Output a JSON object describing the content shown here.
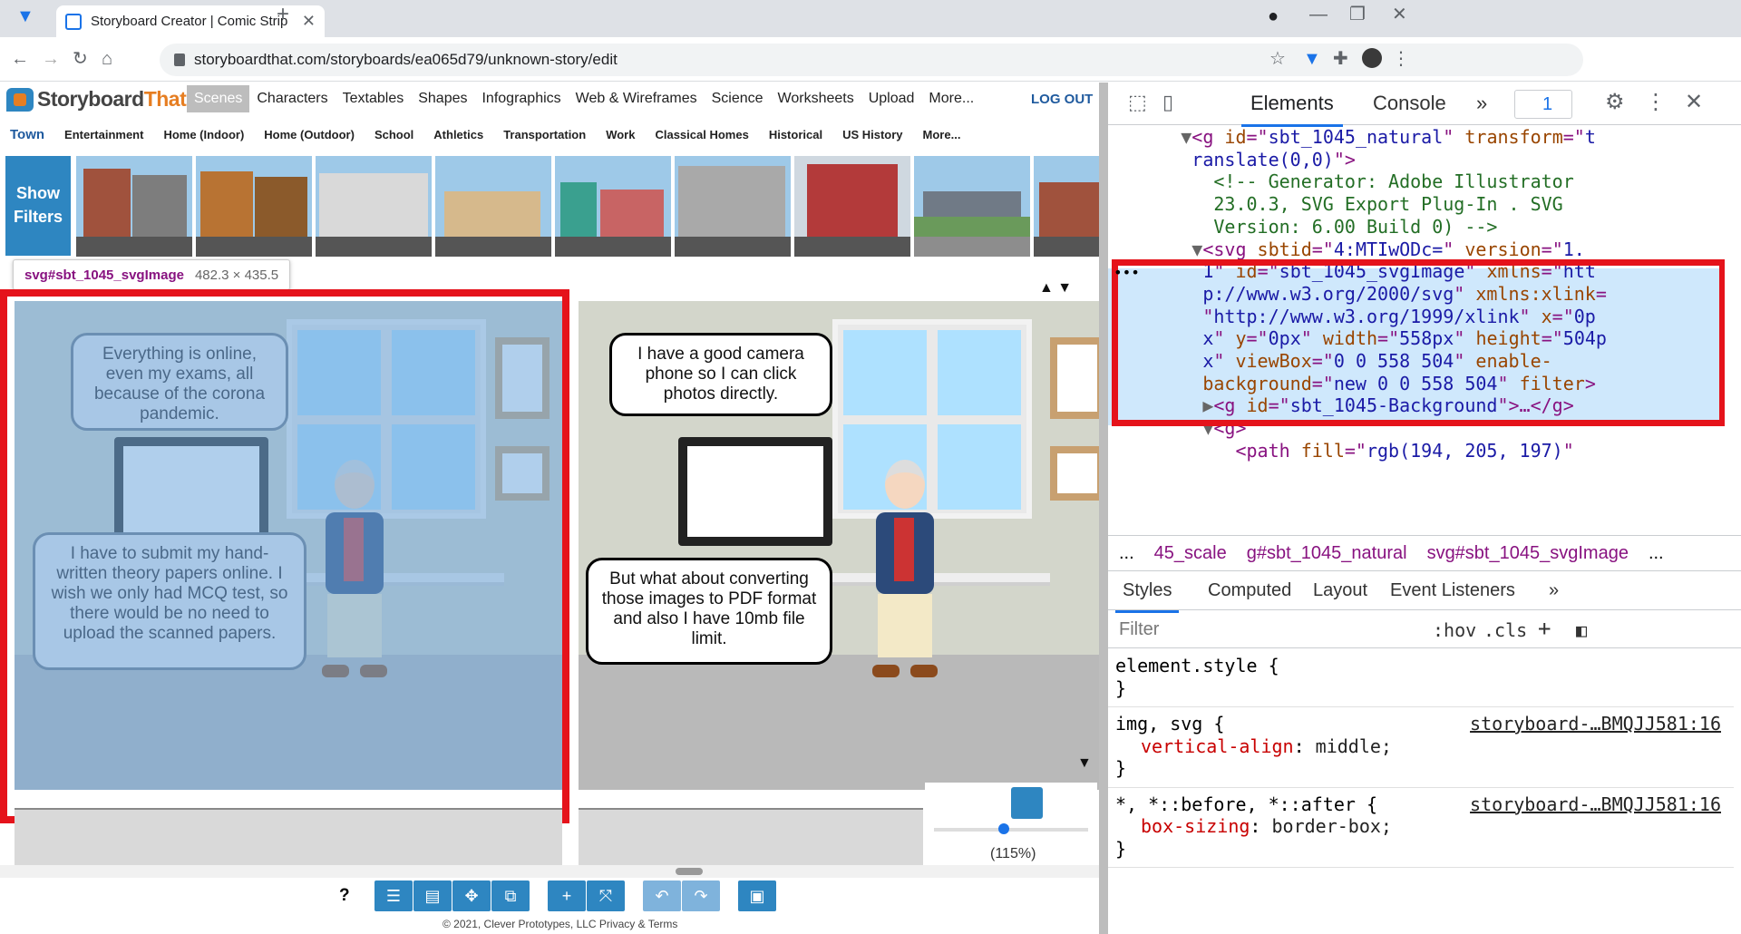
{
  "browser": {
    "tab_title": "Storyboard Creator | Comic Strip",
    "url": "storyboardthat.com/storyboards/ea065d79/unknown-story/edit"
  },
  "site": {
    "logo_text_a": "Storyboard",
    "logo_text_b": "That",
    "nav": [
      "Scenes",
      "Characters",
      "Textables",
      "Shapes",
      "Infographics",
      "Web & Wireframes",
      "Science",
      "Worksheets",
      "Upload",
      "More..."
    ],
    "logout": "LOG OUT",
    "subnav": [
      "Town",
      "Entertainment",
      "Home (Indoor)",
      "Home (Outdoor)",
      "School",
      "Athletics",
      "Transportation",
      "Work",
      "Classical Homes",
      "Historical",
      "US History",
      "More..."
    ],
    "show_filters": "Show Filters"
  },
  "tooltip": {
    "selector": "svg#sbt_1045_svgImage",
    "size": "482.3 × 435.5"
  },
  "comic": {
    "cell1": {
      "bubble_top": "Everything is online, even my exams, all because of the corona pandemic.",
      "bubble_bottom": "I have to submit my hand-written theory papers online. I wish we only had MCQ test, so there would be no need to upload the scanned papers."
    },
    "cell2": {
      "bubble_top": "I have a good camera phone so I can click photos directly.",
      "bubble_bottom": "But what about converting those images to PDF format and also I have 10mb file limit."
    }
  },
  "zoom": {
    "label": "(115%)",
    "level_fraction": 0.45
  },
  "footer": {
    "help": "?",
    "copyright": "© 2021, Clever Prototypes, LLC Privacy & Terms"
  },
  "devtools": {
    "tabs": [
      "Elements",
      "Console"
    ],
    "issues_count": "1",
    "dom_lines": [
      {
        "indent": "      ",
        "arrow": "▼",
        "parts": [
          [
            "tg",
            "<g "
          ],
          [
            "an",
            "id"
          ],
          [
            "tg",
            "=\""
          ],
          [
            "av",
            "sbt_1045_natural"
          ],
          [
            "tg",
            "\" "
          ],
          [
            "an",
            "transform"
          ],
          [
            "tg",
            "=\""
          ],
          [
            "av",
            "t"
          ]
        ]
      },
      {
        "indent": "      ",
        "arrow": "",
        "parts": [
          [
            "av",
            "ranslate(0,0)"
          ],
          [
            "tg",
            "\">"
          ]
        ]
      },
      {
        "indent": "        ",
        "arrow": "",
        "parts": [
          [
            "cm",
            "<!-- Generator: Adobe Illustrator"
          ]
        ]
      },
      {
        "indent": "        ",
        "arrow": "",
        "parts": [
          [
            "cm",
            "23.0.3, SVG Export Plug-In . SVG"
          ]
        ]
      },
      {
        "indent": "        ",
        "arrow": "",
        "parts": [
          [
            "cm",
            "Version: 6.00 Build 0) -->"
          ]
        ]
      },
      {
        "indent": "       ",
        "arrow": "▼",
        "parts": [
          [
            "tg",
            "<svg "
          ],
          [
            "an",
            "sbtid"
          ],
          [
            "tg",
            "=\""
          ],
          [
            "av",
            "4:MTIwODc="
          ],
          [
            "tg",
            "\" "
          ],
          [
            "an",
            "version"
          ],
          [
            "tg",
            "=\""
          ],
          [
            "av",
            "1."
          ]
        ]
      },
      {
        "indent": "       ",
        "arrow": "",
        "parts": [
          [
            "av",
            "1"
          ],
          [
            "tg",
            "\" "
          ],
          [
            "an",
            "id"
          ],
          [
            "tg",
            "=\""
          ],
          [
            "av",
            "sbt_1045_svgImage"
          ],
          [
            "tg",
            "\" "
          ],
          [
            "an",
            "xmlns"
          ],
          [
            "tg",
            "=\""
          ],
          [
            "av",
            "htt"
          ]
        ]
      },
      {
        "indent": "       ",
        "arrow": "",
        "parts": [
          [
            "av",
            "p://www.w3.org/2000/svg"
          ],
          [
            "tg",
            "\" "
          ],
          [
            "an",
            "xmlns:xlink"
          ],
          [
            "tg",
            "="
          ]
        ]
      },
      {
        "indent": "       ",
        "arrow": "",
        "parts": [
          [
            "tg",
            "\""
          ],
          [
            "av",
            "http://www.w3.org/1999/xlink"
          ],
          [
            "tg",
            "\" "
          ],
          [
            "an",
            "x"
          ],
          [
            "tg",
            "=\""
          ],
          [
            "av",
            "0p"
          ]
        ]
      },
      {
        "indent": "       ",
        "arrow": "",
        "parts": [
          [
            "av",
            "x"
          ],
          [
            "tg",
            "\" "
          ],
          [
            "an",
            "y"
          ],
          [
            "tg",
            "=\""
          ],
          [
            "av",
            "0px"
          ],
          [
            "tg",
            "\" "
          ],
          [
            "an",
            "width"
          ],
          [
            "tg",
            "=\""
          ],
          [
            "av",
            "558px"
          ],
          [
            "tg",
            "\" "
          ],
          [
            "an",
            "height"
          ],
          [
            "tg",
            "=\""
          ],
          [
            "av",
            "504p"
          ]
        ]
      },
      {
        "indent": "       ",
        "arrow": "",
        "parts": [
          [
            "av",
            "x"
          ],
          [
            "tg",
            "\" "
          ],
          [
            "an",
            "viewBox"
          ],
          [
            "tg",
            "=\""
          ],
          [
            "av",
            "0 0 558 504"
          ],
          [
            "tg",
            "\" "
          ],
          [
            "an",
            "enable-"
          ]
        ]
      },
      {
        "indent": "       ",
        "arrow": "",
        "parts": [
          [
            "an",
            "background"
          ],
          [
            "tg",
            "=\""
          ],
          [
            "av",
            "new 0 0 558 504"
          ],
          [
            "tg",
            "\" "
          ],
          [
            "an",
            "filter"
          ],
          [
            "tg",
            ">"
          ]
        ]
      },
      {
        "indent": "        ",
        "arrow": "▶",
        "parts": [
          [
            "tg",
            "<g "
          ],
          [
            "an",
            "id"
          ],
          [
            "tg",
            "=\""
          ],
          [
            "av",
            "sbt_1045-Background"
          ],
          [
            "tg",
            "\">…</g>"
          ]
        ]
      },
      {
        "indent": "        ",
        "arrow": "▼",
        "parts": [
          [
            "tg",
            "<g>"
          ]
        ]
      },
      {
        "indent": "          ",
        "arrow": "",
        "parts": [
          [
            "tg",
            "<path "
          ],
          [
            "an",
            "fill"
          ],
          [
            "tg",
            "=\""
          ],
          [
            "av",
            "rgb(194, 205, 197)"
          ],
          [
            "tg",
            "\""
          ]
        ]
      }
    ],
    "crumbs": [
      "...",
      "45_scale",
      "g#sbt_1045_natural",
      "svg#sbt_1045_svgImage",
      "..."
    ],
    "style_tabs": [
      "Styles",
      "Computed",
      "Layout",
      "Event Listeners"
    ],
    "filter_placeholder": "Filter",
    "hov": ":hov",
    "cls": ".cls",
    "rules": [
      {
        "selector": "element.style {",
        "source": "",
        "decls": [],
        "close": "}"
      },
      {
        "selector": "img, svg {",
        "source": "storyboard-…BMQJJ581:16",
        "decls": [
          [
            "vertical-align",
            "middle;"
          ]
        ],
        "close": "}"
      },
      {
        "selector": "*, *::before, *::after {",
        "source": "storyboard-…BMQJJ581:16",
        "decls": [
          [
            "box-sizing",
            "border-box;"
          ]
        ],
        "close": "}"
      }
    ]
  },
  "colors": {
    "highlight": "#e5131b",
    "brand_blue": "#2e86c1",
    "logo_orange": "#e67e22"
  }
}
